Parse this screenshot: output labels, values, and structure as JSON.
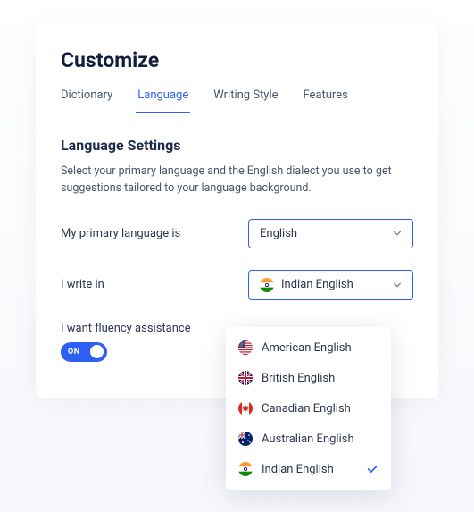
{
  "title": "Customize",
  "tabs": [
    {
      "label": "Dictionary",
      "active": false
    },
    {
      "label": "Language",
      "active": true
    },
    {
      "label": "Writing Style",
      "active": false
    },
    {
      "label": "Features",
      "active": false
    }
  ],
  "section": {
    "heading": "Language Settings",
    "description": "Select your primary language and the English dialect you use to get suggestions tailored to your language background."
  },
  "primary_language": {
    "label": "My primary language is",
    "value": "English"
  },
  "dialect": {
    "label": "I write in",
    "value": "Indian English",
    "options": [
      {
        "label": "American English",
        "flag": "us",
        "selected": false
      },
      {
        "label": "British English",
        "flag": "gb",
        "selected": false
      },
      {
        "label": "Canadian English",
        "flag": "ca",
        "selected": false
      },
      {
        "label": "Australian English",
        "flag": "au",
        "selected": false
      },
      {
        "label": "Indian English",
        "flag": "in",
        "selected": true
      }
    ]
  },
  "fluency": {
    "label": "I want fluency assistance",
    "state": "ON"
  },
  "colors": {
    "accent": "#2d5ff3"
  }
}
